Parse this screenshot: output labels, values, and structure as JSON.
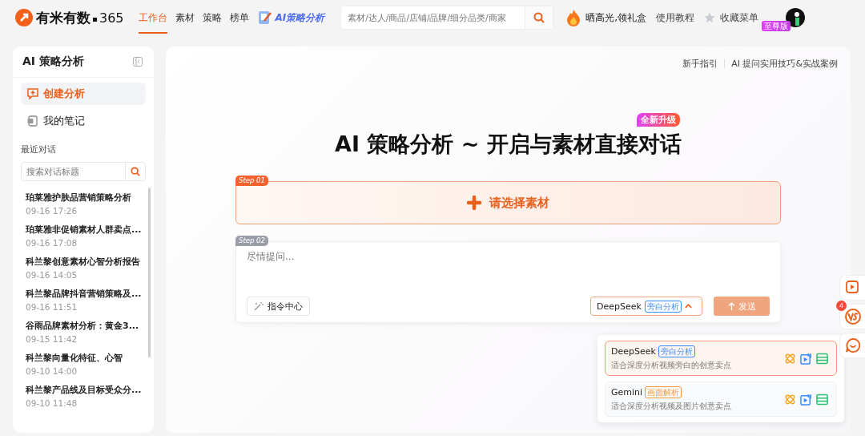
{
  "header": {
    "logo_text": "有米有数",
    "logo_suffix": "365",
    "nav": [
      {
        "label": "工作台",
        "selected": true
      },
      {
        "label": "素材",
        "selected": false
      },
      {
        "label": "策略",
        "selected": false
      },
      {
        "label": "榜单",
        "selected": false
      }
    ],
    "ai_nav": "AI策略分析",
    "search": {
      "placeholder": "素材/达人/商品/店铺/品牌/细分品类/商家"
    },
    "promo": "晒高光,领礼盒",
    "tutorial": "使用教程",
    "favorites": "收藏菜单",
    "badge": "至尊版"
  },
  "sidebar": {
    "title": "AI 策略分析",
    "menu": [
      {
        "label": "创建分析",
        "selected": true
      },
      {
        "label": "我的笔记",
        "selected": false
      }
    ],
    "recent_label": "最近对话",
    "search": {
      "placeholder": "搜索对话标题"
    },
    "history": [
      {
        "title": "珀莱雅护肤品营销策略分析",
        "time": "09-16 17:26"
      },
      {
        "title": "珀莱雅非促销素材人群卖点...",
        "time": "09-16 17:08"
      },
      {
        "title": "科兰黎创意素材心智分析报告",
        "time": "09-16 14:05"
      },
      {
        "title": "科兰黎品牌抖音营销策略及...",
        "time": "09-16 11:51"
      },
      {
        "title": "谷雨品牌素材分析：黄金3...",
        "time": "09-15 11:42"
      },
      {
        "title": "科兰黎向量化特征、心智",
        "time": "09-10 14:00"
      },
      {
        "title": "科兰黎产品线及目标受众分...",
        "time": "09-10 11:48"
      }
    ]
  },
  "main": {
    "links": [
      "新手指引",
      "AI 提问实用技巧&实战案例"
    ],
    "title": "AI 策略分析 ~ 开启与素材直接对话",
    "title_badge": "全新升级",
    "step1": {
      "tag": "Step 01",
      "label": "请选择素材"
    },
    "step2": {
      "tag": "Step 02",
      "placeholder": "尽情提问...",
      "command_button": "指令中心",
      "model_select": {
        "value": "DeepSeek",
        "tag": "旁白分析",
        "expanded": true
      },
      "send_button": "发送"
    },
    "model_options": [
      {
        "name": "DeepSeek",
        "tag": "旁白分析",
        "color": "#3b8cf5",
        "description": "适合深度分析视频旁白的创意卖点",
        "selected": true
      },
      {
        "name": "Gemini",
        "tag": "画面解析",
        "color": "#f59a3b",
        "description": "适合深度分析视频及图片创意卖点",
        "selected": false
      }
    ]
  },
  "float_bar": {
    "vs_count": "4"
  }
}
